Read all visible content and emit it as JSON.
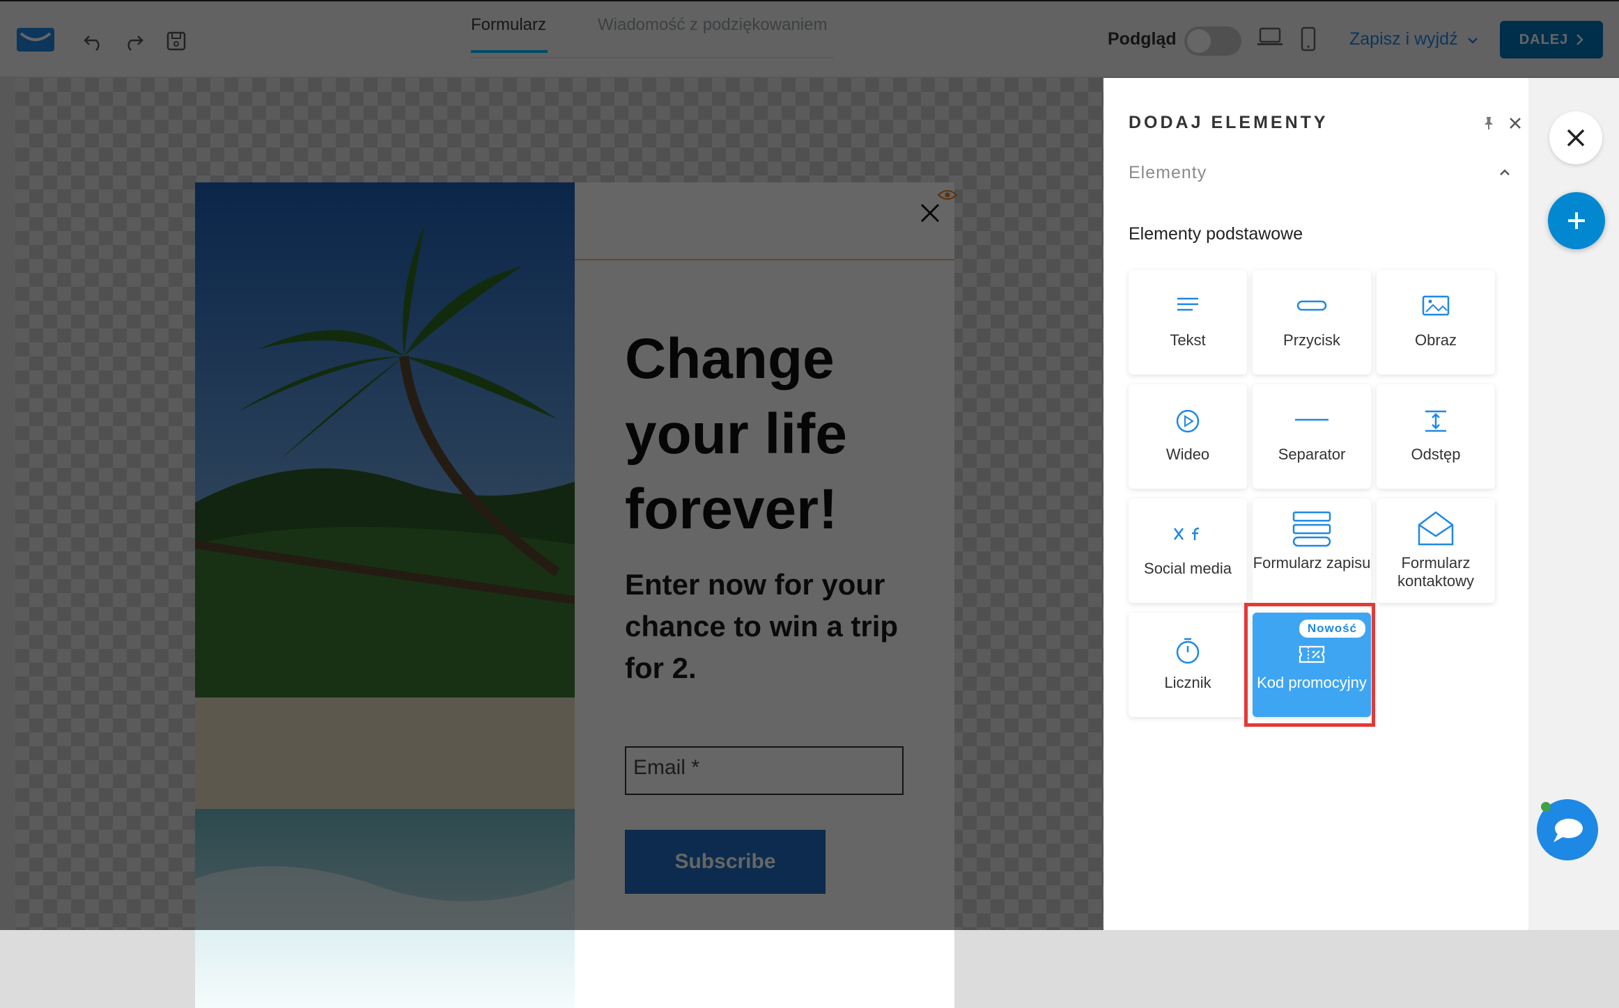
{
  "topbar": {
    "tabs": [
      {
        "label": "Formularz",
        "active": true
      },
      {
        "label": "Wiadomość z podziękowaniem",
        "active": false
      }
    ],
    "preview_label": "Podgląd",
    "save_exit_label": "Zapisz i wyjdź",
    "next_label": "DALEJ"
  },
  "popup": {
    "headline": "Change your life forever!",
    "subline": "Enter now for your chance to win a trip for 2.",
    "email_placeholder": "Email *",
    "subscribe_label": "Subscribe"
  },
  "panel": {
    "title": "DODAJ ELEMENTY",
    "section": "Elementy",
    "subsection": "Elementy podstawowe",
    "tiles": [
      {
        "label": "Tekst",
        "icon": "text-icon"
      },
      {
        "label": "Przycisk",
        "icon": "button-icon"
      },
      {
        "label": "Obraz",
        "icon": "image-icon"
      },
      {
        "label": "Wideo",
        "icon": "video-icon"
      },
      {
        "label": "Separator",
        "icon": "separator-icon"
      },
      {
        "label": "Odstęp",
        "icon": "spacing-icon"
      },
      {
        "label": "Social media",
        "icon": "social-icon"
      },
      {
        "label": "Formularz zapisu",
        "icon": "signup-form-icon"
      },
      {
        "label": "Formularz kontaktowy",
        "icon": "contact-form-icon"
      },
      {
        "label": "Licznik",
        "icon": "timer-icon"
      },
      {
        "label": "Kod promocyjny",
        "icon": "promo-code-icon",
        "badge": "Nowość"
      }
    ]
  },
  "colors": {
    "accent": "#0277bd",
    "link": "#1e88e5",
    "promo_tile": "#3ea5f2",
    "highlight": "#e53935",
    "subscribe": "#1f6cc3"
  }
}
